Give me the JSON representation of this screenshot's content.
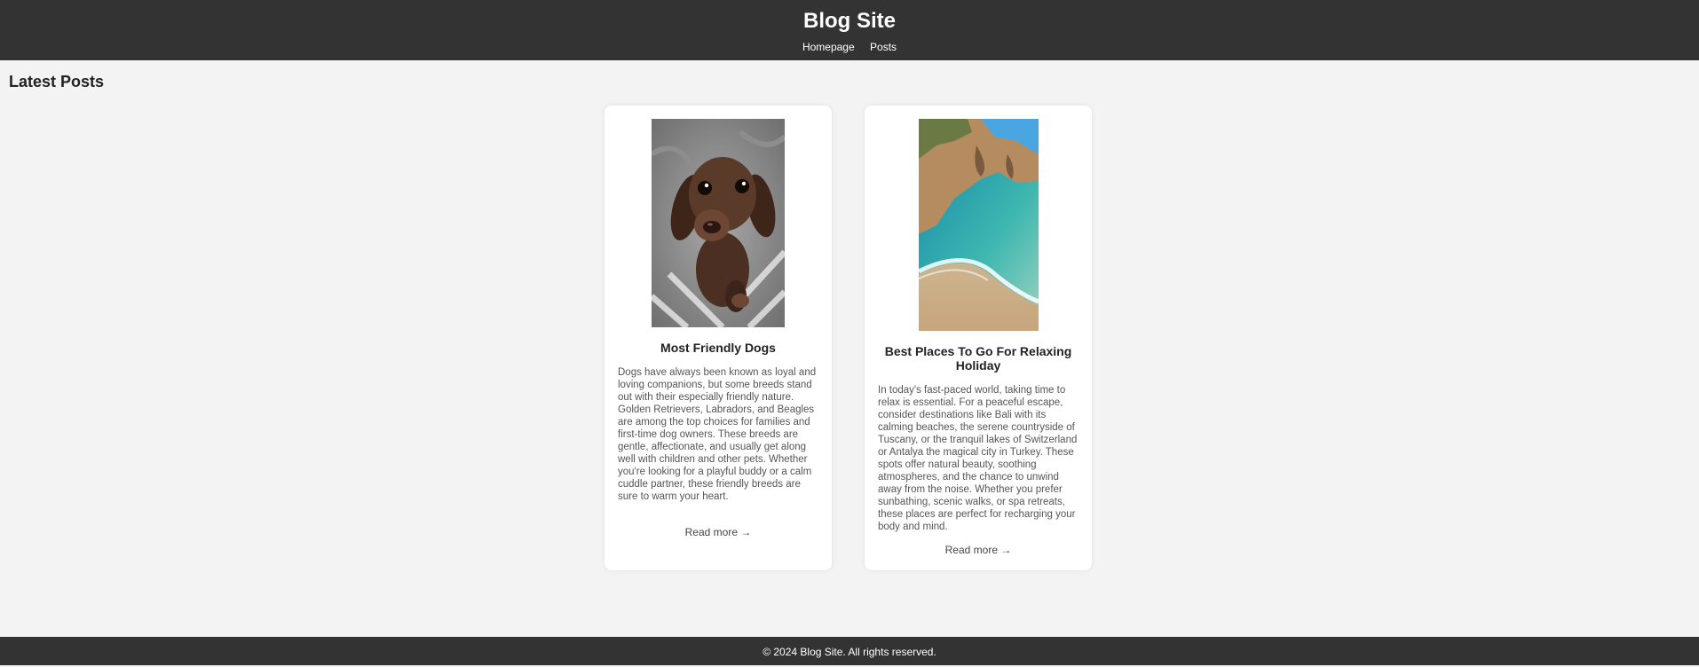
{
  "header": {
    "title": "Blog Site",
    "nav": [
      "Homepage",
      "Posts"
    ]
  },
  "main": {
    "section_title": "Latest Posts",
    "posts": [
      {
        "title": "Most Friendly Dogs",
        "image": "dachshund-puppy-photo",
        "excerpt": "Dogs have always been known as loyal and loving companions, but some breeds stand out with their especially friendly nature. Golden Retrievers, Labradors, and Beagles are among the top choices for families and first-time dog owners. These breeds are gentle, affectionate, and usually get along well with children and other pets. Whether you're looking for a playful buddy or a calm cuddle partner, these friendly breeds are sure to warm your heart.",
        "read_more": "Read more →"
      },
      {
        "title": "Best Places To Go For Relaxing Holiday",
        "image": "beach-cliff-photo",
        "excerpt": "In today's fast-paced world, taking time to relax is essential. For a peaceful escape, consider destinations like Bali with its calming beaches, the serene countryside of Tuscany, or the tranquil lakes of Switzerland or Antalya the magical city in Turkey. These spots offer natural beauty, soothing atmospheres, and the chance to unwind away from the noise. Whether you prefer sunbathing, scenic walks, or spa retreats, these places are perfect for recharging your body and mind.",
        "read_more": "Read more →"
      }
    ]
  },
  "footer": {
    "text": "© 2024 Blog Site. All rights reserved."
  },
  "colors": {
    "header_bg": "#333333",
    "page_bg": "#f3f3f3",
    "card_bg": "#ffffff"
  }
}
